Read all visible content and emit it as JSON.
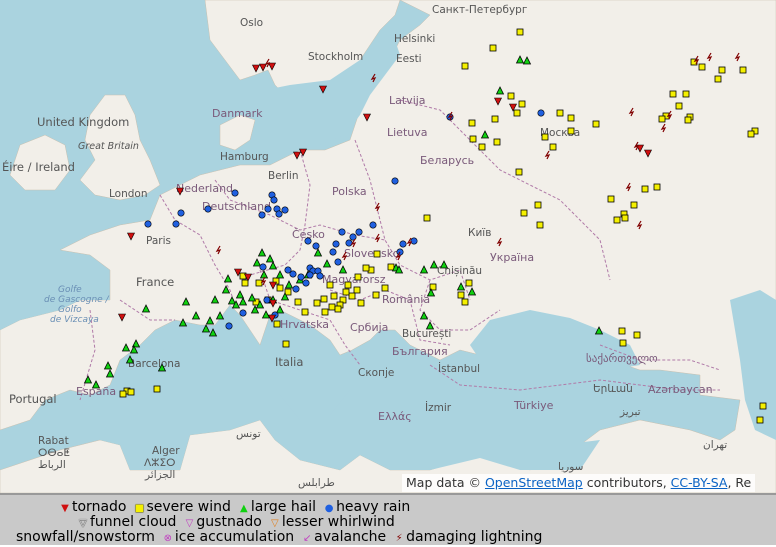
{
  "map": {
    "colors": {
      "sea": "#aad3df",
      "land": "#f2efe9",
      "border": "#b07aa8",
      "tornado": "#d01010",
      "wind": "#f5f000",
      "hail": "#10d010",
      "rain": "#2060e0",
      "lightning": "#800000"
    },
    "labels": {
      "oslo": "Oslo",
      "stockholm": "Stockholm",
      "helsinki": "Helsinki",
      "spb": "Санкт-Петербург",
      "eesti": "Eesti",
      "danmark": "Danmark",
      "latvija": "Latvija",
      "uk": "United Kingdom",
      "gb": "Great Britain",
      "lietuva": "Lietuva",
      "moskva": "Москва",
      "ireland": "Éire / Ireland",
      "hamburg": "Hamburg",
      "belarus": "Беларусь",
      "berlin": "Berlin",
      "london": "London",
      "nederland": "Nederland",
      "polska": "Polska",
      "deutschland": "Deutschland",
      "paris": "Paris",
      "cesko": "Česko",
      "kyiv": "Київ",
      "slovensko": "Slovensko",
      "ukraina": "Україна",
      "france": "France",
      "magyar": "Magyarorsz",
      "chisinau": "Chișinău",
      "gascogne1": "Golfe",
      "gascogne2": "de Gascogne /",
      "gascogne3": "Golfo",
      "gascogne4": "de Vizcaya",
      "romania": "România",
      "hrvatska": "Hrvatska",
      "srbija": "Србија",
      "bucuresti": "București",
      "bulgaria": "България",
      "italia": "Italia",
      "sakartvelo": "საქართველო",
      "barcelona": "Barcelona",
      "skopje": "Скопје",
      "istanbul": "İstanbul",
      "yerevan": "Երևան",
      "azerbaycan": "Azərbaycan",
      "portugal": "Portugal",
      "espana": "España",
      "turkiye": "Türkiye",
      "ellas": "Ελλάς",
      "izmir": "İzmir",
      "tabriz": "تبریز",
      "rabat1": "Rabat",
      "rabat2": "ⵔⴱⴰⵟ",
      "rabat3": "الرباط",
      "alger1": "Alger",
      "alger2": "ⴷⵣⵉⵔ",
      "alger3": "الجزائر",
      "tunis": "تونس",
      "tehran": "تهران",
      "suriya": "سوريا",
      "tarabulus": "طرابلس"
    }
  },
  "attribution": {
    "prefix": "Map data © ",
    "osm": "OpenStreetMap",
    "middle": " contributors, ",
    "license": "CC-BY-SA",
    "suffix": ", Re"
  },
  "legend": {
    "row1": [
      {
        "label": "tornado",
        "icon": "tornado-icon",
        "symbol": "▼",
        "color": "#d01010"
      },
      {
        "label": "severe wind",
        "icon": "wind-icon",
        "symbol": "■",
        "color": "#f5f000"
      },
      {
        "label": "large hail",
        "icon": "hail-icon",
        "symbol": "▲",
        "color": "#10d010"
      },
      {
        "label": "heavy rain",
        "icon": "rain-icon",
        "symbol": "●",
        "color": "#2060e0"
      }
    ],
    "row2": [
      {
        "label": "funnel cloud",
        "icon": "funnel-cloud-icon",
        "symbol": "▽",
        "color": "#ffffff"
      },
      {
        "label": "gustnado",
        "icon": "gustnado-icon",
        "symbol": "▽",
        "color": "#c040c0"
      },
      {
        "label": "lesser whirlwind",
        "icon": "whirlwind-icon",
        "symbol": "▽",
        "color": "#e08020"
      }
    ],
    "row3": [
      {
        "label": "snowfall/snowstorm",
        "icon": "snowfall-icon",
        "symbol": "",
        "color": "#ffffff"
      },
      {
        "label": "ice accumulation",
        "icon": "ice-icon",
        "symbol": "⊗",
        "color": "#c040c0"
      },
      {
        "label": "avalanche",
        "icon": "avalanche-icon",
        "symbol": "↙",
        "color": "#c040c0"
      },
      {
        "label": "damaging lightning",
        "icon": "lightning-icon",
        "symbol": "⚡",
        "color": "#800000"
      }
    ]
  }
}
